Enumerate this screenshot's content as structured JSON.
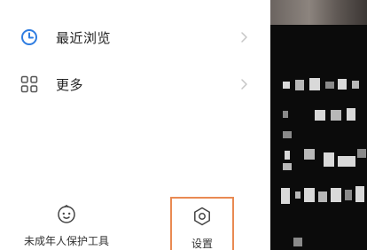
{
  "menu": {
    "items": [
      {
        "label": "最近浏览",
        "icon": "clock-icon"
      },
      {
        "label": "更多",
        "icon": "grid-icon"
      }
    ]
  },
  "bottom_tools": {
    "minor_protection": {
      "label": "未成年人保护工具",
      "icon": "smiley-icon"
    },
    "settings": {
      "label": "设置",
      "icon": "gear-icon",
      "highlight_color": "#e98a52"
    }
  },
  "colors": {
    "accent_blue": "#2f7de1",
    "text": "#222222",
    "chevron": "#c6c6c6",
    "background_dim": "#0b0b0b"
  }
}
